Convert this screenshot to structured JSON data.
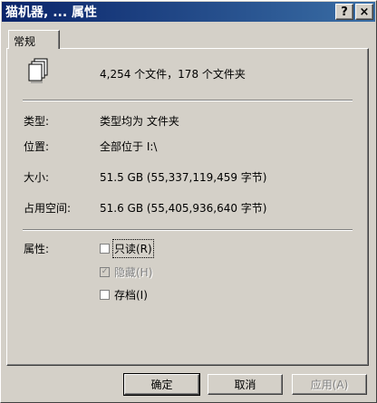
{
  "window": {
    "title": "猫机器, ... 属性",
    "help_glyph": "?",
    "close_glyph": "×"
  },
  "tabs": [
    {
      "label": "常规"
    }
  ],
  "general": {
    "summary_icon": "files-icon",
    "summary": "4,254 个文件，178 个文件夹",
    "type_label": "类型:",
    "type_value": "类型均为 文件夹",
    "location_label": "位置:",
    "location_value": "全部位于 I:\\",
    "size_label": "大小:",
    "size_value": "51.5 GB (55,337,119,459 字节)",
    "size_on_disk_label": "占用空间:",
    "size_on_disk_value": "51.6 GB (55,405,936,640 字节)",
    "attributes_label": "属性:",
    "attributes": [
      {
        "label": "只读(R)",
        "checked": false,
        "enabled": true
      },
      {
        "label": "隐藏(H)",
        "checked": true,
        "enabled": false
      },
      {
        "label": "存档(I)",
        "checked": false,
        "enabled": true
      }
    ]
  },
  "buttons": {
    "ok": "确定",
    "cancel": "取消",
    "apply": "应用(A)"
  }
}
